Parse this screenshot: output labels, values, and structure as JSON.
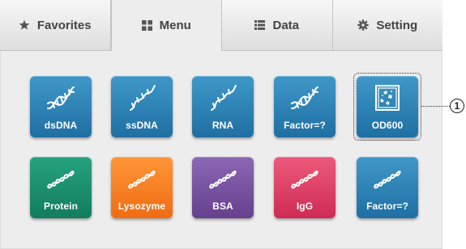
{
  "tabs": [
    {
      "label": "Favorites",
      "icon": "star-icon"
    },
    {
      "label": "Menu",
      "icon": "grid-icon"
    },
    {
      "label": "Data",
      "icon": "list-icon"
    },
    {
      "label": "Setting",
      "icon": "gear-icon"
    }
  ],
  "active_tab": "Menu",
  "tiles": {
    "dsdna": {
      "label": "dsDNA",
      "icon": "double-helix-icon",
      "color": "#2a7fb4"
    },
    "ssdna": {
      "label": "ssDNA",
      "icon": "single-strand-icon",
      "color": "#2a7fb4"
    },
    "rna": {
      "label": "RNA",
      "icon": "single-strand-icon",
      "color": "#2a7fb4"
    },
    "factor_nucleic": {
      "label": "Factor=?",
      "icon": "double-helix-icon",
      "color": "#2a7fb4"
    },
    "od600": {
      "label": "OD600",
      "icon": "cuvette-cells-icon",
      "color": "#2a7fb4"
    },
    "protein": {
      "label": "Protein",
      "icon": "protein-icon",
      "color": "#1a8d6b"
    },
    "lysozyme": {
      "label": "Lysozyme",
      "icon": "protein-icon",
      "color": "#f57c20"
    },
    "bsa": {
      "label": "BSA",
      "icon": "protein-icon",
      "color": "#744f9f"
    },
    "igg": {
      "label": "IgG",
      "icon": "protein-icon",
      "color": "#dd3d64"
    },
    "factor_protein": {
      "label": "Factor=?",
      "icon": "protein-icon",
      "color": "#2a7fb4"
    }
  },
  "callout": {
    "number": "1"
  }
}
